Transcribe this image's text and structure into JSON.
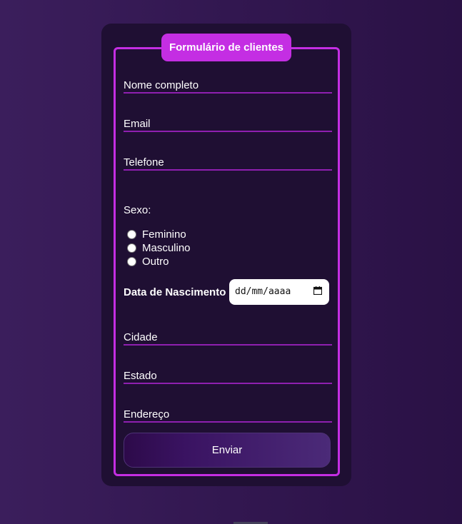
{
  "form": {
    "legend": "Formulário de clientes",
    "fields": {
      "nome": "Nome completo",
      "email": "Email",
      "telefone": "Telefone",
      "cidade": "Cidade",
      "estado": "Estado",
      "endereco": "Endereço"
    },
    "sexo_label": "Sexo:",
    "sexo_options": [
      "Feminino",
      "Masculino",
      "Outro"
    ],
    "nascimento_label": "Data de Nascimento",
    "nascimento_placeholder": "dd/mm/aaaa",
    "submit_label": "Enviar"
  },
  "colors": {
    "background": "#321750",
    "card": "#1f0f33",
    "accent": "#c42ee3",
    "underline": "#8f1fb0"
  }
}
